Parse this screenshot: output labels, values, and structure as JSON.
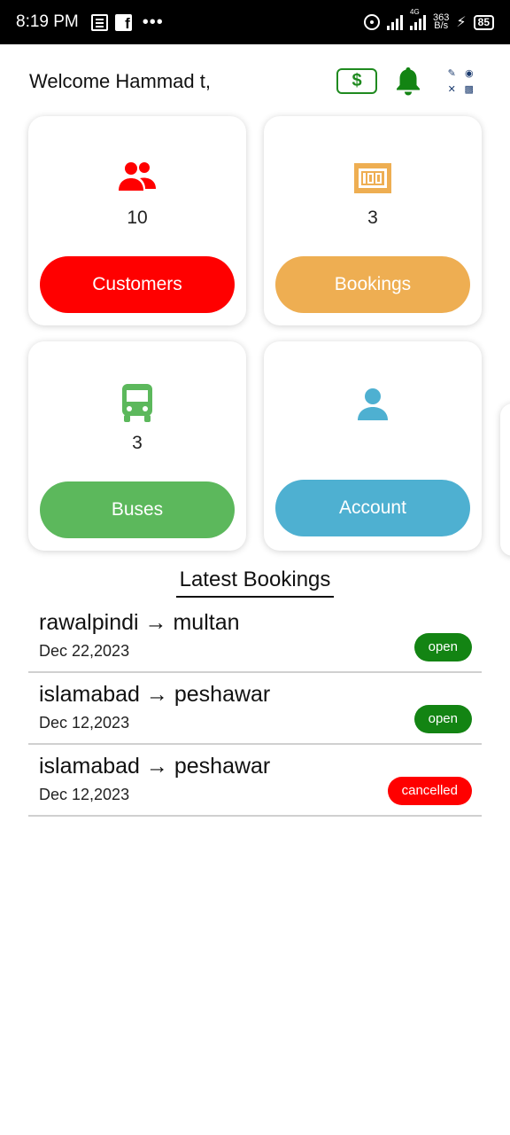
{
  "status_bar": {
    "time": "8:19 PM",
    "dots": "•••",
    "network_type": "4G",
    "speed_value": "363",
    "speed_unit": "B/s",
    "battery": "85",
    "icons": [
      "news-icon",
      "facebook-icon",
      "hotspot-icon",
      "signal-icon",
      "charging-icon",
      "battery-icon"
    ]
  },
  "header": {
    "welcome": "Welcome Hammad t,",
    "dollar_label": "$",
    "icons": [
      "dollar-icon",
      "bell-icon",
      "menu-grid-icon"
    ]
  },
  "colors": {
    "red": "#ff0000",
    "orange": "#eeae52",
    "green": "#5cb85c",
    "blue": "#4eb0d1",
    "dark_green": "#138413"
  },
  "cards": [
    {
      "icon": "customers-icon",
      "count": "10",
      "label": "Customers"
    },
    {
      "icon": "ticket-icon",
      "count": "3",
      "label": "Bookings"
    },
    {
      "icon": "bus-icon",
      "count": "3",
      "label": "Buses"
    },
    {
      "icon": "account-icon",
      "count": "",
      "label": "Account"
    }
  ],
  "latest_bookings": {
    "title": "Latest Bookings",
    "items": [
      {
        "from": "rawalpindi",
        "to": "multan",
        "arrow": "→",
        "date": "Dec 22,2023",
        "status": "open"
      },
      {
        "from": "islamabad",
        "to": "peshawar",
        "arrow": "→",
        "date": "Dec 12,2023",
        "status": "open"
      },
      {
        "from": "islamabad",
        "to": "peshawar",
        "arrow": "→",
        "date": "Dec 12,2023",
        "status": "cancelled"
      }
    ]
  }
}
